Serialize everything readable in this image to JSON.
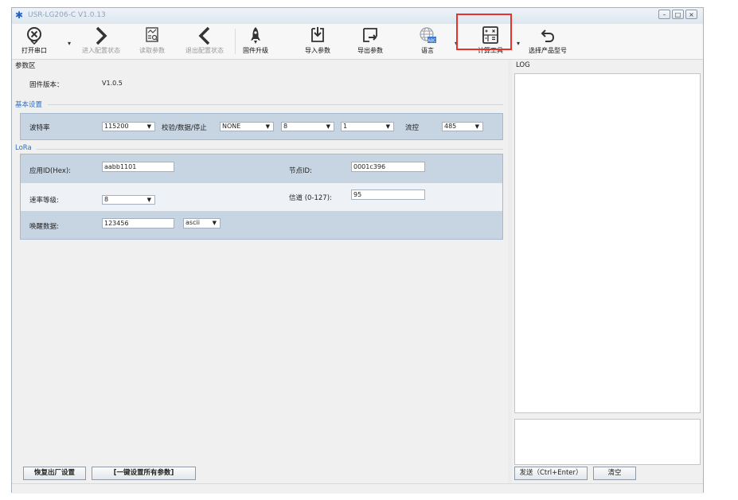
{
  "window": {
    "title": "USR-LG206-C  V1.0.13",
    "min": "–",
    "max": "□",
    "close": "×"
  },
  "toolbar": {
    "open_port": "打开串口",
    "enter_config": "进入配置状态",
    "read_params": "读取参数",
    "exit_config": "退出配置状态",
    "firmware_upgrade": "固件升级",
    "import_params": "导入参数",
    "export_params": "导出参数",
    "language": "语言",
    "calc_tool": "计算工具",
    "select_model": "选择产品型号",
    "dropdown": "▾"
  },
  "params": {
    "section_title": "参数区",
    "firmware_label": "固件版本：",
    "firmware_value": "V1.0.5"
  },
  "basic": {
    "title": "基本设置",
    "baud_label": "波特率",
    "baud_value": "115200",
    "parity_label": "校验/数据/停止",
    "parity_value": "NONE",
    "data_bits": "8",
    "stop_bits": "1",
    "flow_label": "流控",
    "flow_value": "485"
  },
  "lora": {
    "title": "LoRa",
    "app_id_label": "应用ID(Hex):",
    "app_id_value": "aabb1101",
    "node_id_label": "节点ID:",
    "node_id_value": "0001c396",
    "rate_label": "速率等级:",
    "rate_value": "8",
    "channel_label": "信道 (0-127):",
    "channel_value": "95",
    "wake_label": "唤醒数据:",
    "wake_value": "123456",
    "wake_format": "ascii"
  },
  "bottom": {
    "restore_factory": "恢复出厂设置",
    "set_all": "[一键设置所有参数]"
  },
  "log": {
    "title": "LOG",
    "send_button": "发送（Ctrl+Enter）",
    "clear_button": "清空"
  },
  "icons": {
    "open_port": "close-circle-icon",
    "enter_config": "chevron-right-icon",
    "read_params": "read-chart-icon",
    "exit_config": "chevron-left-icon",
    "firmware_upgrade": "rocket-icon",
    "import_params": "import-icon",
    "export_params": "export-icon",
    "language": "globe-icon",
    "calc_tool": "calculator-icon",
    "select_model": "undo-arrow-icon"
  },
  "colors": {
    "highlight": "#e8322b",
    "section_blue": "#2f6fc0",
    "band": "#c7d5e3"
  }
}
